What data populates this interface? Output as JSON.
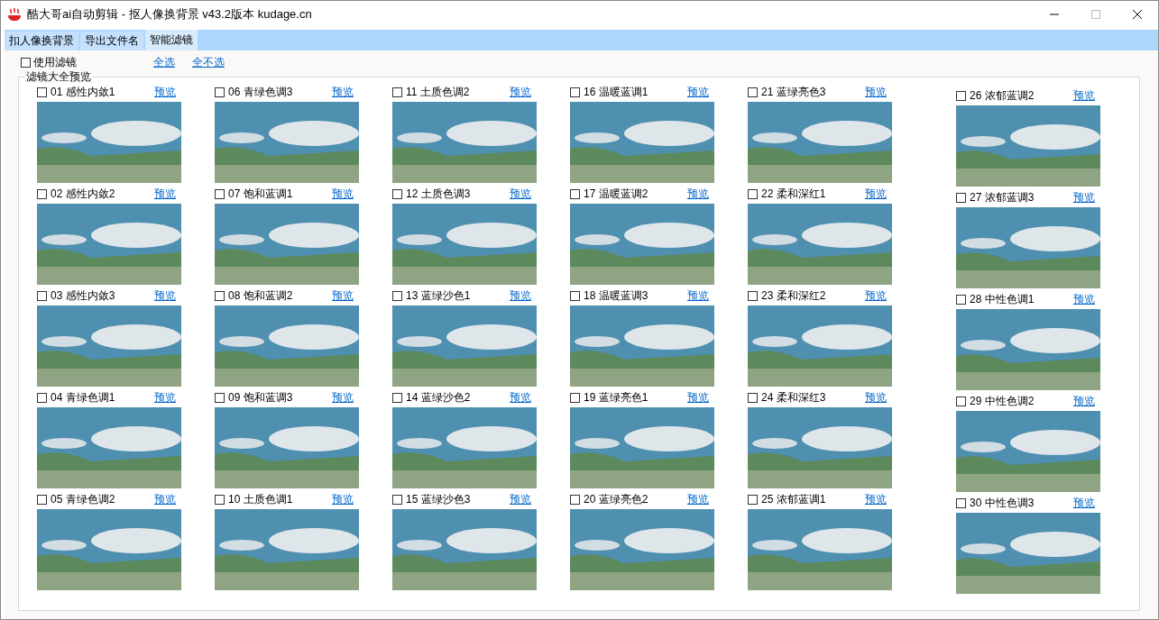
{
  "window": {
    "title": "酷大哥ai自动剪辑 -  抠人像换背景  v43.2版本  kudage.cn"
  },
  "tabs": [
    {
      "label": "扣人像换背景",
      "selected": false
    },
    {
      "label": "导出文件名",
      "selected": false
    },
    {
      "label": "智能滤镜",
      "selected": true
    }
  ],
  "use_filter": {
    "label": "使用滤镜",
    "checked": false
  },
  "links": [
    "全选",
    "全不选"
  ],
  "group": {
    "title": "滤镜大全预览",
    "columns": [
      [
        {
          "label": "01 感性内敛1",
          "link": "预览",
          "checked": false
        },
        {
          "label": "02 感性内敛2",
          "link": "预览",
          "checked": false
        },
        {
          "label": "03 感性内敛3",
          "link": "预览",
          "checked": false
        },
        {
          "label": "04 青绿色调1",
          "link": "预览",
          "checked": false
        },
        {
          "label": "05 青绿色调2",
          "link": "预览",
          "checked": false
        }
      ],
      [
        {
          "label": "06 青绿色调3",
          "link": "预览",
          "checked": false
        },
        {
          "label": "07 饱和蓝调1",
          "link": "预览",
          "checked": false
        },
        {
          "label": "08 饱和蓝调2",
          "link": "预览",
          "checked": false
        },
        {
          "label": "09 饱和蓝调3",
          "link": "预览",
          "checked": false
        },
        {
          "label": "10 土质色调1",
          "link": "预览",
          "checked": false
        }
      ],
      [
        {
          "label": "11 土质色调2",
          "link": "预览",
          "checked": false
        },
        {
          "label": "12 土质色调3",
          "link": "预览",
          "checked": false
        },
        {
          "label": "13 蓝绿沙色1",
          "link": "预览",
          "checked": false
        },
        {
          "label": "14 蓝绿沙色2",
          "link": "预览",
          "checked": false
        },
        {
          "label": "15 蓝绿沙色3",
          "link": "预览",
          "checked": false
        }
      ],
      [
        {
          "label": "16 温暖蓝调1",
          "link": "预览",
          "checked": false
        },
        {
          "label": "17 温暖蓝调2",
          "link": "预览",
          "checked": false
        },
        {
          "label": "18 温暖蓝调3",
          "link": "预览",
          "checked": false
        },
        {
          "label": "19 蓝绿亮色1",
          "link": "预览",
          "checked": false
        },
        {
          "label": "20 蓝绿亮色2",
          "link": "预览",
          "checked": false
        }
      ],
      [
        {
          "label": "21 蓝绿亮色3",
          "link": "预览",
          "checked": false
        },
        {
          "label": "22 柔和深红1",
          "link": "预览",
          "checked": false
        },
        {
          "label": "23 柔和深红2",
          "link": "预览",
          "checked": false
        },
        {
          "label": "24 柔和深红3",
          "link": "预览",
          "checked": false
        },
        {
          "label": "25 浓郁蓝调1",
          "link": "预览",
          "checked": false
        }
      ],
      [
        {
          "label": "26 浓郁蓝调2",
          "link": "预览",
          "checked": false
        },
        {
          "label": "27 浓郁蓝调3",
          "link": "预览",
          "checked": false
        },
        {
          "label": "28 中性色调1",
          "link": "预览",
          "checked": false
        },
        {
          "label": "29 中性色调2",
          "link": "预览",
          "checked": false
        },
        {
          "label": "30 中性色调3",
          "link": "预览",
          "checked": false
        }
      ]
    ]
  }
}
